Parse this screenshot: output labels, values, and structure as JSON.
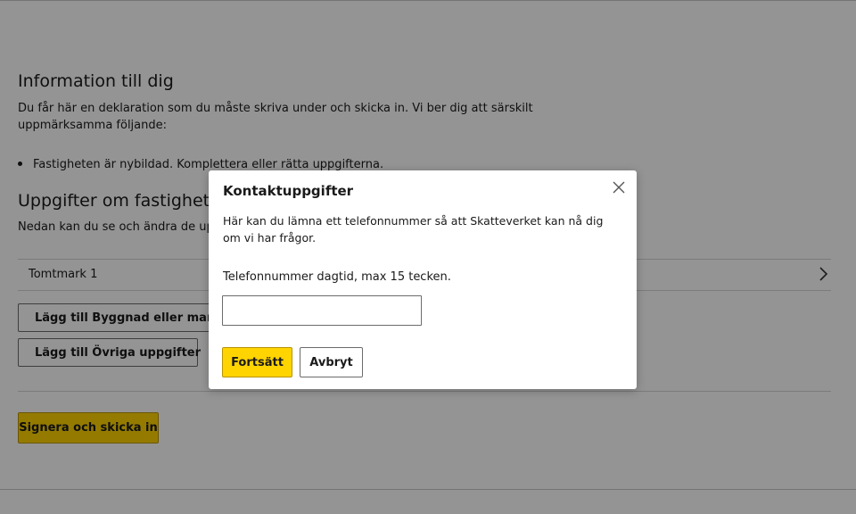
{
  "info": {
    "heading": "Information till dig",
    "paragraph_line1": "Du får här en deklaration som du måste skriva under och skicka in. Vi ber dig att särskilt",
    "paragraph_line2": "uppmärksamma följande:",
    "bullets": [
      "Fastigheten är nybildad. Komplettera eller rätta uppgifterna."
    ]
  },
  "property": {
    "heading": "Uppgifter om fastigheten",
    "subtext": "Nedan kan du se och ändra de uppgifter",
    "items": [
      {
        "label": "Tomtmark 1"
      }
    ],
    "add_building_label": "Lägg till Byggnad eller mark",
    "add_other_label": "Lägg till Övriga uppgifter"
  },
  "submit": {
    "label": "Signera och skicka in"
  },
  "colors": {
    "accent": "#ffd400",
    "accent_border": "#b89300",
    "overlay": "rgba(0,0,0,0.42)"
  },
  "modal": {
    "title": "Kontaktuppgifter",
    "description": "Här kan du lämna ett telefonnummer så att Skatteverket kan nå dig om vi har frågor.",
    "phone_label": "Telefonnummer dagtid, max 15 tecken.",
    "phone_value": "",
    "continue_label": "Fortsätt",
    "cancel_label": "Avbryt"
  }
}
